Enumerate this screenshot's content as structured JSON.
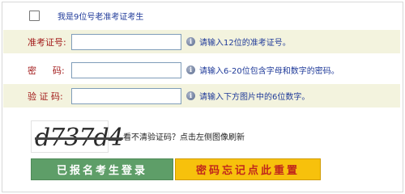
{
  "checkbox": {
    "label": "我是9位号老准考证考生",
    "checked": false
  },
  "fields": [
    {
      "label": "准考证号:",
      "value": "",
      "hint": "请输入12位的准考证号。"
    },
    {
      "label_a": "密",
      "label_b": "码:",
      "value": "",
      "hint": "请输入6-20位包含字母和数字的密码。"
    },
    {
      "label": "验 证 码:",
      "value": "",
      "hint": "请输入下方图片中的6位数字。"
    }
  ],
  "captcha": {
    "image_text": "d737d4",
    "hint": "看不清验证码？点击左侧图像刷新"
  },
  "buttons": {
    "login": "已报名考生登录",
    "reset": "密码忘记点此重置"
  },
  "icons": {
    "info": "info-icon"
  },
  "colors": {
    "label_red": "#a21a1a",
    "hint_blue": "#1f3a99",
    "row_shade": "#f3f3de",
    "login_green": "#5e9e68",
    "reset_yellow": "#f7c10c"
  }
}
